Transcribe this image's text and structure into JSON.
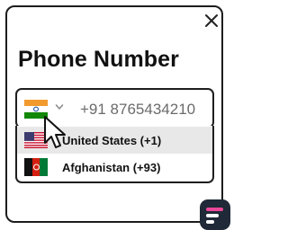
{
  "title": "Phone Number",
  "phone_input": {
    "selected_country_flag": "india-flag",
    "value": "+91 8765434210"
  },
  "dropdown": {
    "options": [
      {
        "label": "United States (+1)",
        "flag": "us-flag",
        "highlighted": true
      },
      {
        "label": "Afghanistan (+93)",
        "flag": "afghanistan-flag",
        "highlighted": false
      }
    ]
  },
  "icons": {
    "close": "close-icon",
    "chevron": "chevron-down-icon",
    "cursor": "cursor-icon",
    "logo": "brand-logo-icon"
  },
  "colors": {
    "border": "#1e1e1e",
    "highlight": "#e8e8e8",
    "india_saffron": "#f29a2e",
    "india_green": "#138808",
    "brand_dark": "#1f2937",
    "brand_pink": "#ec4899"
  }
}
